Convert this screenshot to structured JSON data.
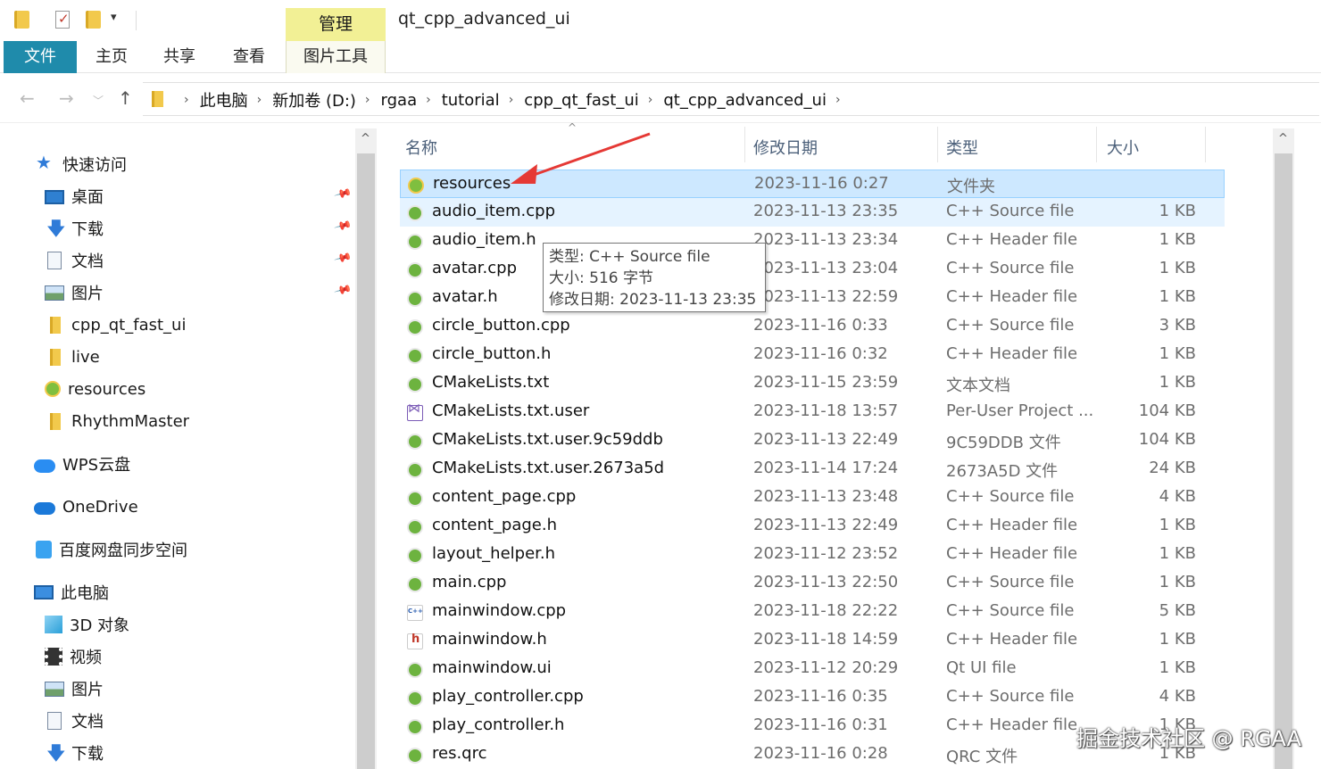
{
  "window": {
    "title": "qt_cpp_advanced_ui",
    "context_tab": "管理"
  },
  "ribbon": {
    "tabs": [
      "文件",
      "主页",
      "共享",
      "查看",
      "图片工具"
    ]
  },
  "qat": {
    "dropdown": "▾"
  },
  "address": {
    "crumbs": [
      "此电脑",
      "新加卷 (D:)",
      "rgaa",
      "tutorial",
      "cpp_qt_fast_ui",
      "qt_cpp_advanced_ui"
    ],
    "separator": "›",
    "back": "←",
    "forward": "→",
    "recent": "﹀",
    "up": "↑"
  },
  "sidebar": {
    "quick_access": "快速访问",
    "quick_items": [
      {
        "label": "桌面",
        "icon": "desktop-icon"
      },
      {
        "label": "下载",
        "icon": "download-icon"
      },
      {
        "label": "文档",
        "icon": "document-icon"
      },
      {
        "label": "图片",
        "icon": "picture-icon"
      }
    ],
    "folders": [
      "cpp_qt_fast_ui",
      "live",
      "resources",
      "RhythmMaster"
    ],
    "wps": "WPS云盘",
    "onedrive": "OneDrive",
    "baidu": "百度网盘同步空间",
    "this_pc": "此电脑",
    "pc_items": [
      "3D 对象",
      "视频",
      "图片",
      "文档",
      "下载"
    ],
    "pin_glyph": "📌"
  },
  "columns": {
    "name": "名称",
    "date": "修改日期",
    "type": "类型",
    "size": "大小",
    "sort_glyph": "^"
  },
  "files": [
    {
      "name": "resources",
      "date": "2023-11-16 0:27",
      "type": "文件夹",
      "size": "",
      "icon": "folder-res"
    },
    {
      "name": "audio_item.cpp",
      "date": "2023-11-13 23:35",
      "type": "C++ Source file",
      "size": "1 KB",
      "icon": "qt"
    },
    {
      "name": "audio_item.h",
      "date": "2023-11-13 23:34",
      "type": "C++ Header file",
      "size": "1 KB",
      "icon": "qt"
    },
    {
      "name": "avatar.cpp",
      "date": "2023-11-13 23:04",
      "type": "C++ Source file",
      "size": "1 KB",
      "icon": "qt"
    },
    {
      "name": "avatar.h",
      "date": "2023-11-13 22:59",
      "type": "C++ Header file",
      "size": "1 KB",
      "icon": "qt"
    },
    {
      "name": "circle_button.cpp",
      "date": "2023-11-16 0:33",
      "type": "C++ Source file",
      "size": "3 KB",
      "icon": "qt"
    },
    {
      "name": "circle_button.h",
      "date": "2023-11-16 0:32",
      "type": "C++ Header file",
      "size": "1 KB",
      "icon": "qt"
    },
    {
      "name": "CMakeLists.txt",
      "date": "2023-11-15 23:59",
      "type": "文本文档",
      "size": "1 KB",
      "icon": "qt"
    },
    {
      "name": "CMakeLists.txt.user",
      "date": "2023-11-18 13:57",
      "type": "Per-User Project ...",
      "size": "104 KB",
      "icon": "vs"
    },
    {
      "name": "CMakeLists.txt.user.9c59ddb",
      "date": "2023-11-13 22:49",
      "type": "9C59DDB 文件",
      "size": "104 KB",
      "icon": "qt"
    },
    {
      "name": "CMakeLists.txt.user.2673a5d",
      "date": "2023-11-14 17:24",
      "type": "2673A5D 文件",
      "size": "24 KB",
      "icon": "qt"
    },
    {
      "name": "content_page.cpp",
      "date": "2023-11-13 23:48",
      "type": "C++ Source file",
      "size": "4 KB",
      "icon": "qt"
    },
    {
      "name": "content_page.h",
      "date": "2023-11-13 22:49",
      "type": "C++ Header file",
      "size": "1 KB",
      "icon": "qt"
    },
    {
      "name": "layout_helper.h",
      "date": "2023-11-12 23:52",
      "type": "C++ Header file",
      "size": "1 KB",
      "icon": "qt"
    },
    {
      "name": "main.cpp",
      "date": "2023-11-13 22:50",
      "type": "C++ Source file",
      "size": "1 KB",
      "icon": "qt"
    },
    {
      "name": "mainwindow.cpp",
      "date": "2023-11-18 22:22",
      "type": "C++ Source file",
      "size": "5 KB",
      "icon": "cpp"
    },
    {
      "name": "mainwindow.h",
      "date": "2023-11-18 14:59",
      "type": "C++ Header file",
      "size": "1 KB",
      "icon": "h"
    },
    {
      "name": "mainwindow.ui",
      "date": "2023-11-12 20:29",
      "type": "Qt UI file",
      "size": "1 KB",
      "icon": "qt"
    },
    {
      "name": "play_controller.cpp",
      "date": "2023-11-16 0:35",
      "type": "C++ Source file",
      "size": "4 KB",
      "icon": "qt"
    },
    {
      "name": "play_controller.h",
      "date": "2023-11-16 0:31",
      "type": "C++ Header file",
      "size": "1 KB",
      "icon": "qt"
    },
    {
      "name": "res.qrc",
      "date": "2023-11-16 0:28",
      "type": "QRC 文件",
      "size": "1 KB",
      "icon": "qt"
    }
  ],
  "tooltip": {
    "type": "类型: C++ Source file",
    "size": "大小: 516 字节",
    "date": "修改日期: 2023-11-13 23:35"
  },
  "scroll": {
    "up": "^"
  },
  "watermark": "掘金技术社区 @ RGAA",
  "colors": {
    "file_tab": "#1f8bab",
    "manage_tab": "#f2f095",
    "selection": "#cde8ff",
    "arrow": "#e53935"
  }
}
